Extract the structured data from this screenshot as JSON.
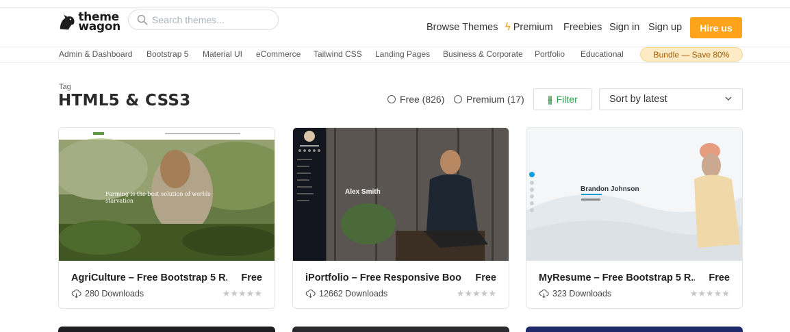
{
  "brand": {
    "line1": "theme",
    "line2": "wagon"
  },
  "search": {
    "placeholder": "Search themes..."
  },
  "nav": {
    "browse": "Browse Themes",
    "premium": "Premium",
    "freebies": "Freebies",
    "signin": "Sign in",
    "signup": "Sign up",
    "hire": "Hire us"
  },
  "categories": [
    "Admin & Dashboard",
    "Bootstrap 5",
    "Material UI",
    "eCommerce",
    "Tailwind CSS",
    "Landing Pages",
    "Business & Corporate",
    "Portfolio",
    "Educational"
  ],
  "bundle": "Bundle — Save 80%",
  "tag": {
    "label": "Tag",
    "title": "HTML5 & CSS3"
  },
  "filters": {
    "free": "Free (826)",
    "premium": "Premium (17)",
    "filter_label": "Filter",
    "sort_value": "Sort by latest"
  },
  "cards": [
    {
      "title": "AgriCulture – Free Bootstrap 5 R...",
      "price": "Free",
      "downloads": "280 Downloads",
      "thumb_text": "Farming is the best solution of worlds starvation",
      "stars": "★★★★★"
    },
    {
      "title": "iPortfolio – Free Responsive Boo...",
      "price": "Free",
      "downloads": "12662 Downloads",
      "thumb_text": "Alex Smith",
      "stars": "★★★★★"
    },
    {
      "title": "MyResume – Free Bootstrap 5 R...",
      "price": "Free",
      "downloads": "323 Downloads",
      "thumb_text": "Brandon Johnson",
      "stars": "★★★★★"
    }
  ],
  "colors": {
    "accent_orange": "#ffa31a",
    "filter_green": "#2ca24c",
    "bundle_bg": "#fdebc6"
  }
}
